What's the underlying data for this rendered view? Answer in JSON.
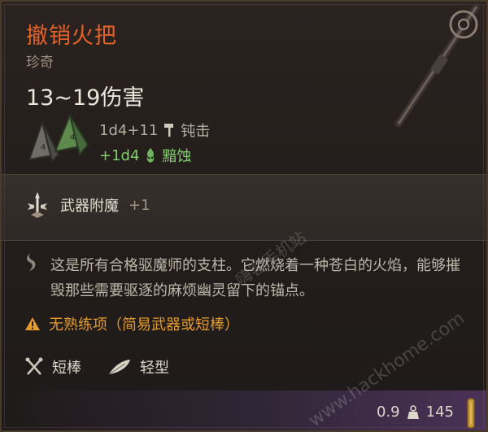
{
  "item": {
    "name": "撤销火把",
    "rarity": "珍奇",
    "damage": "13~19伤害"
  },
  "damage_rows": [
    {
      "dice": "1d4+11",
      "type": "钝击",
      "icon": "hammer-icon"
    },
    {
      "dice": "+1d4",
      "type": "黯蚀",
      "icon": "skull-flame-icon"
    }
  ],
  "enchant": {
    "label": "武器附魔",
    "value": "+1",
    "icon": "weapon-enchant-icon"
  },
  "description": "这是所有合格驱魔师的支柱。它燃烧着一种苍白的火焰，能够摧毁那些需要驱逐的麻烦幽灵留下的锚点。",
  "warning": {
    "text": "无熟练项（简易武器或短棒）",
    "icon": "warning-icon"
  },
  "properties": [
    {
      "label": "短棒",
      "icon": "crossed-clubs-icon"
    },
    {
      "label": "轻型",
      "icon": "feather-icon"
    }
  ],
  "footer": {
    "weight": "0.9",
    "value": "145"
  },
  "watermark": [
    "嗨客手机站",
    "www.hackhome.com"
  ],
  "colors": {
    "title": "#e2622a",
    "rarity": "#9d9081",
    "radiant": "#7fcf6a",
    "warning": "#e59a2c"
  }
}
